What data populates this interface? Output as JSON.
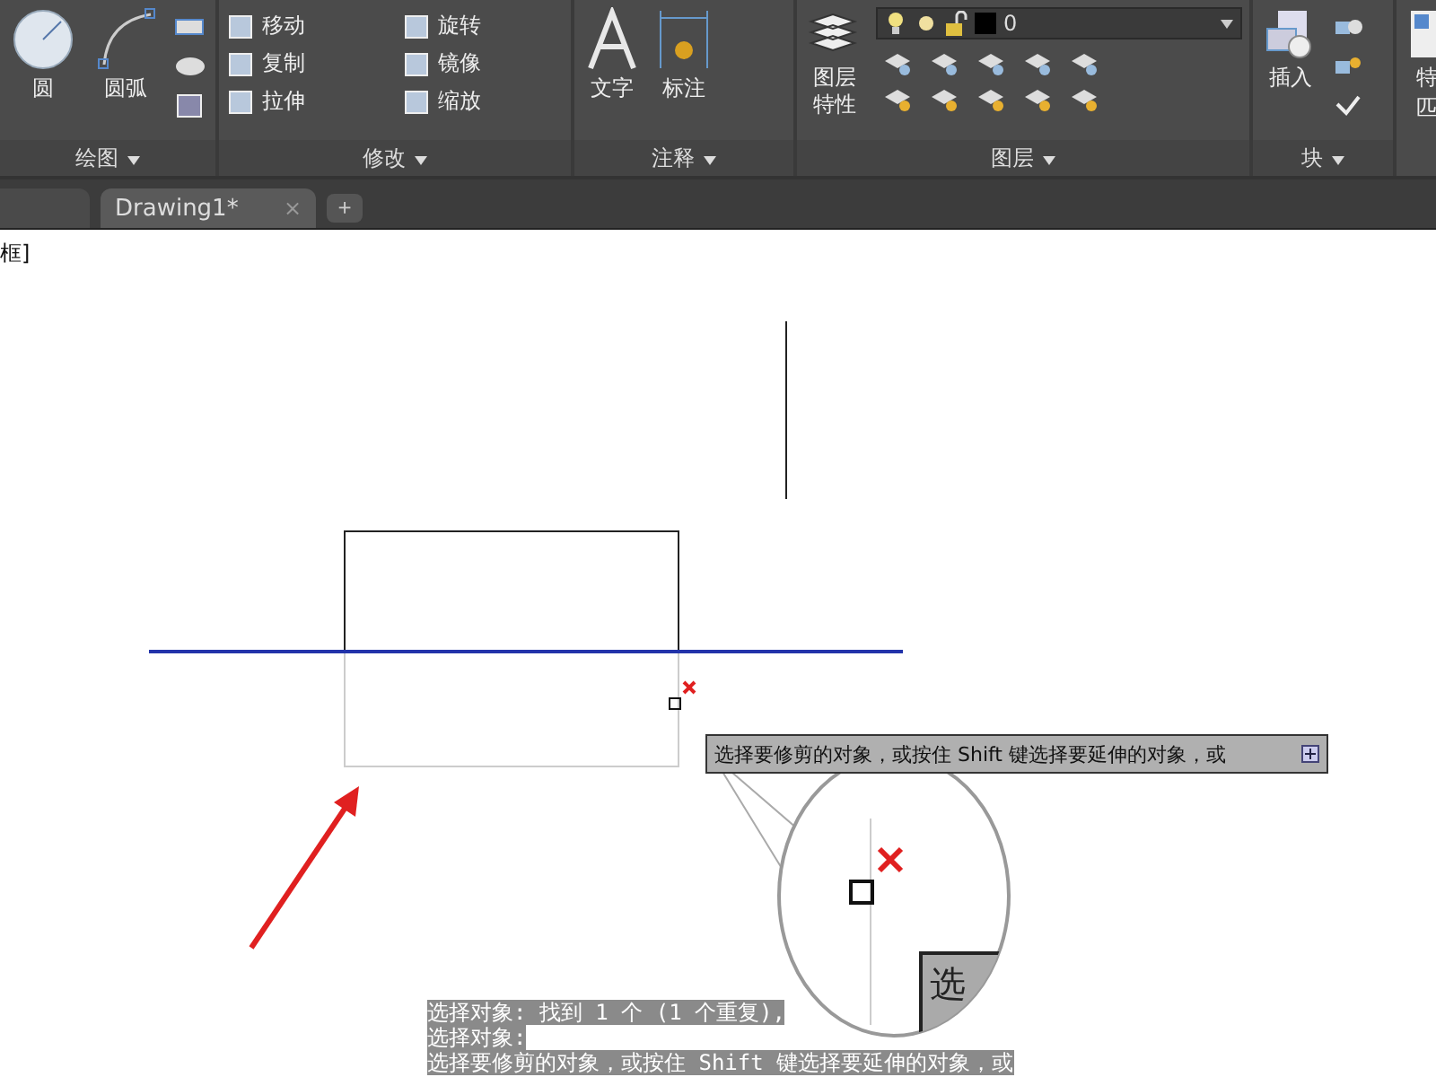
{
  "ribbon": {
    "panels": [
      {
        "title": "绘图",
        "large": [
          "圆",
          "圆弧"
        ]
      },
      {
        "title": "修改",
        "small": [
          "移动",
          "旋转",
          "复制",
          "镜像",
          "拉伸",
          "缩放"
        ]
      },
      {
        "title": "注释",
        "large": [
          "文字",
          "标注"
        ]
      },
      {
        "title": "图层",
        "large": [
          "图层特性"
        ],
        "layer_value": "0"
      },
      {
        "title": "块",
        "large": [
          "插入"
        ]
      },
      {
        "large": [
          "特",
          "匹"
        ]
      }
    ]
  },
  "document_tabs": [
    {
      "selected": false
    },
    {
      "label": "Drawing1*",
      "selected": true
    }
  ],
  "new_tab": "+",
  "close_mark": "×",
  "prompt_fragment": "框]",
  "tooltip": "选择要修剪的对象，或按住 Shift 键选择要延伸的对象，或",
  "magnifier_text": "选",
  "command_lines": [
    "选择对象: 找到 1 个 (1 个重复),",
    "选择对象:",
    "选择要修剪的对象，或按住 Shift 键选择要延伸的对象，或"
  ]
}
